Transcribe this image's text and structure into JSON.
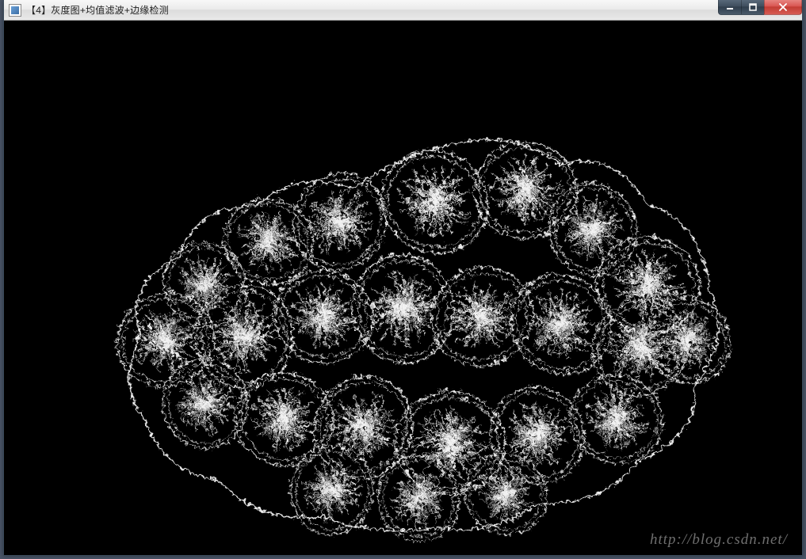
{
  "window": {
    "title": "【4】灰度图+均值滤波+边缘检测",
    "icon_name": "app-icon",
    "controls": {
      "minimize": "minimize",
      "maximize": "maximize",
      "close": "close"
    }
  },
  "content": {
    "description": "Canny edge detection output (grayscale + mean blur + edge detect) of a cluster of round textured objects",
    "background_color": "#000000",
    "edge_color": "#ffffff"
  },
  "watermark": {
    "text": "http://blog.csdn.net/"
  }
}
